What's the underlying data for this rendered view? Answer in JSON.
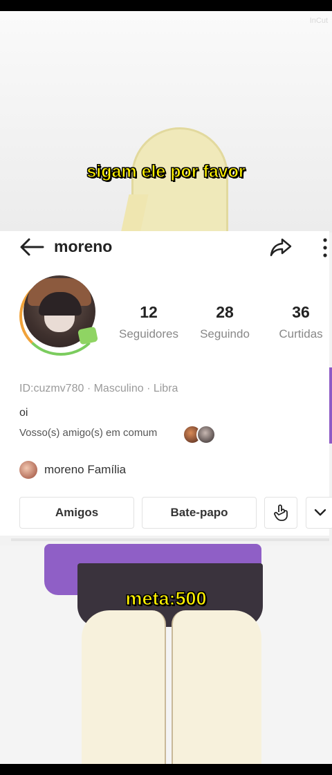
{
  "overlay": {
    "watermark": "InCut",
    "caption_top": "sigam ele por favor",
    "caption_bottom": "meta:500"
  },
  "header": {
    "title": "moreno"
  },
  "stats": [
    {
      "value": "12",
      "label": "Seguidores"
    },
    {
      "value": "28",
      "label": "Seguindo"
    },
    {
      "value": "36",
      "label": "Curtidas"
    }
  ],
  "profile": {
    "meta": "ID:cuzmv780 · Masculino · Libra",
    "bio": "oi",
    "common_friends": "Vosso(s) amigo(s) em comum",
    "family": "moreno Família"
  },
  "actions": {
    "friends": "Amigos",
    "chat": "Bate-papo"
  },
  "colors": {
    "caption": "#fff200",
    "purple": "#8f5fc6"
  }
}
